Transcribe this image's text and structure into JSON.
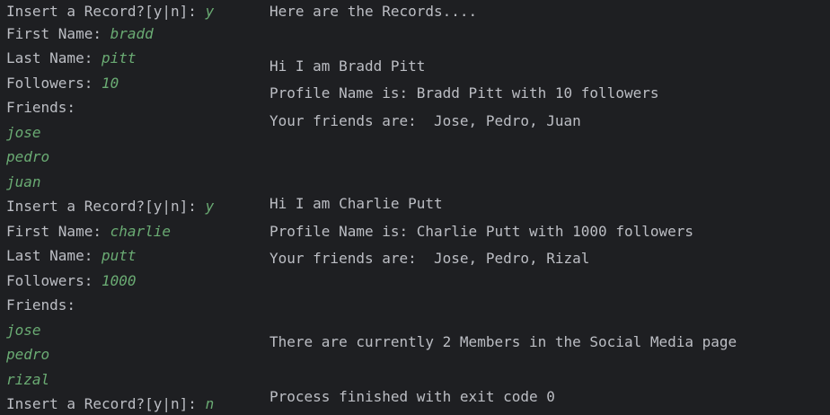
{
  "colors": {
    "background": "#1e1f22",
    "output_text": "#bcbec4",
    "user_input": "#6aab73"
  },
  "left": [
    {
      "prompt": "Insert a Record?[y|n]: ",
      "input": "y"
    },
    {
      "prompt": "First Name: ",
      "input": "bradd"
    },
    {
      "prompt": "Last Name: ",
      "input": "pitt"
    },
    {
      "prompt": "Followers: ",
      "input": "10"
    },
    {
      "prompt": "Friends:",
      "input": ""
    },
    {
      "prompt": "",
      "input": "jose"
    },
    {
      "prompt": "",
      "input": "pedro"
    },
    {
      "prompt": "",
      "input": "juan"
    },
    {
      "prompt": "Insert a Record?[y|n]: ",
      "input": "y"
    },
    {
      "prompt": "First Name: ",
      "input": "charlie"
    },
    {
      "prompt": "Last Name: ",
      "input": "putt"
    },
    {
      "prompt": "Followers: ",
      "input": "1000"
    },
    {
      "prompt": "Friends:",
      "input": ""
    },
    {
      "prompt": "",
      "input": "jose"
    },
    {
      "prompt": "",
      "input": "pedro"
    },
    {
      "prompt": "",
      "input": "rizal"
    },
    {
      "prompt": "Insert a Record?[y|n]: ",
      "input": "n"
    }
  ],
  "right": [
    "Here are the Records....",
    "Hi I am Bradd Pitt",
    "Profile Name is: Bradd Pitt with 10 followers",
    "Your friends are:  Jose, Pedro, Juan",
    "Hi I am Charlie Putt",
    "Profile Name is: Charlie Putt with 1000 followers",
    "Your friends are:  Jose, Pedro, Rizal",
    "There are currently 2 Members in the Social Media page",
    "Process finished with exit code 0"
  ]
}
